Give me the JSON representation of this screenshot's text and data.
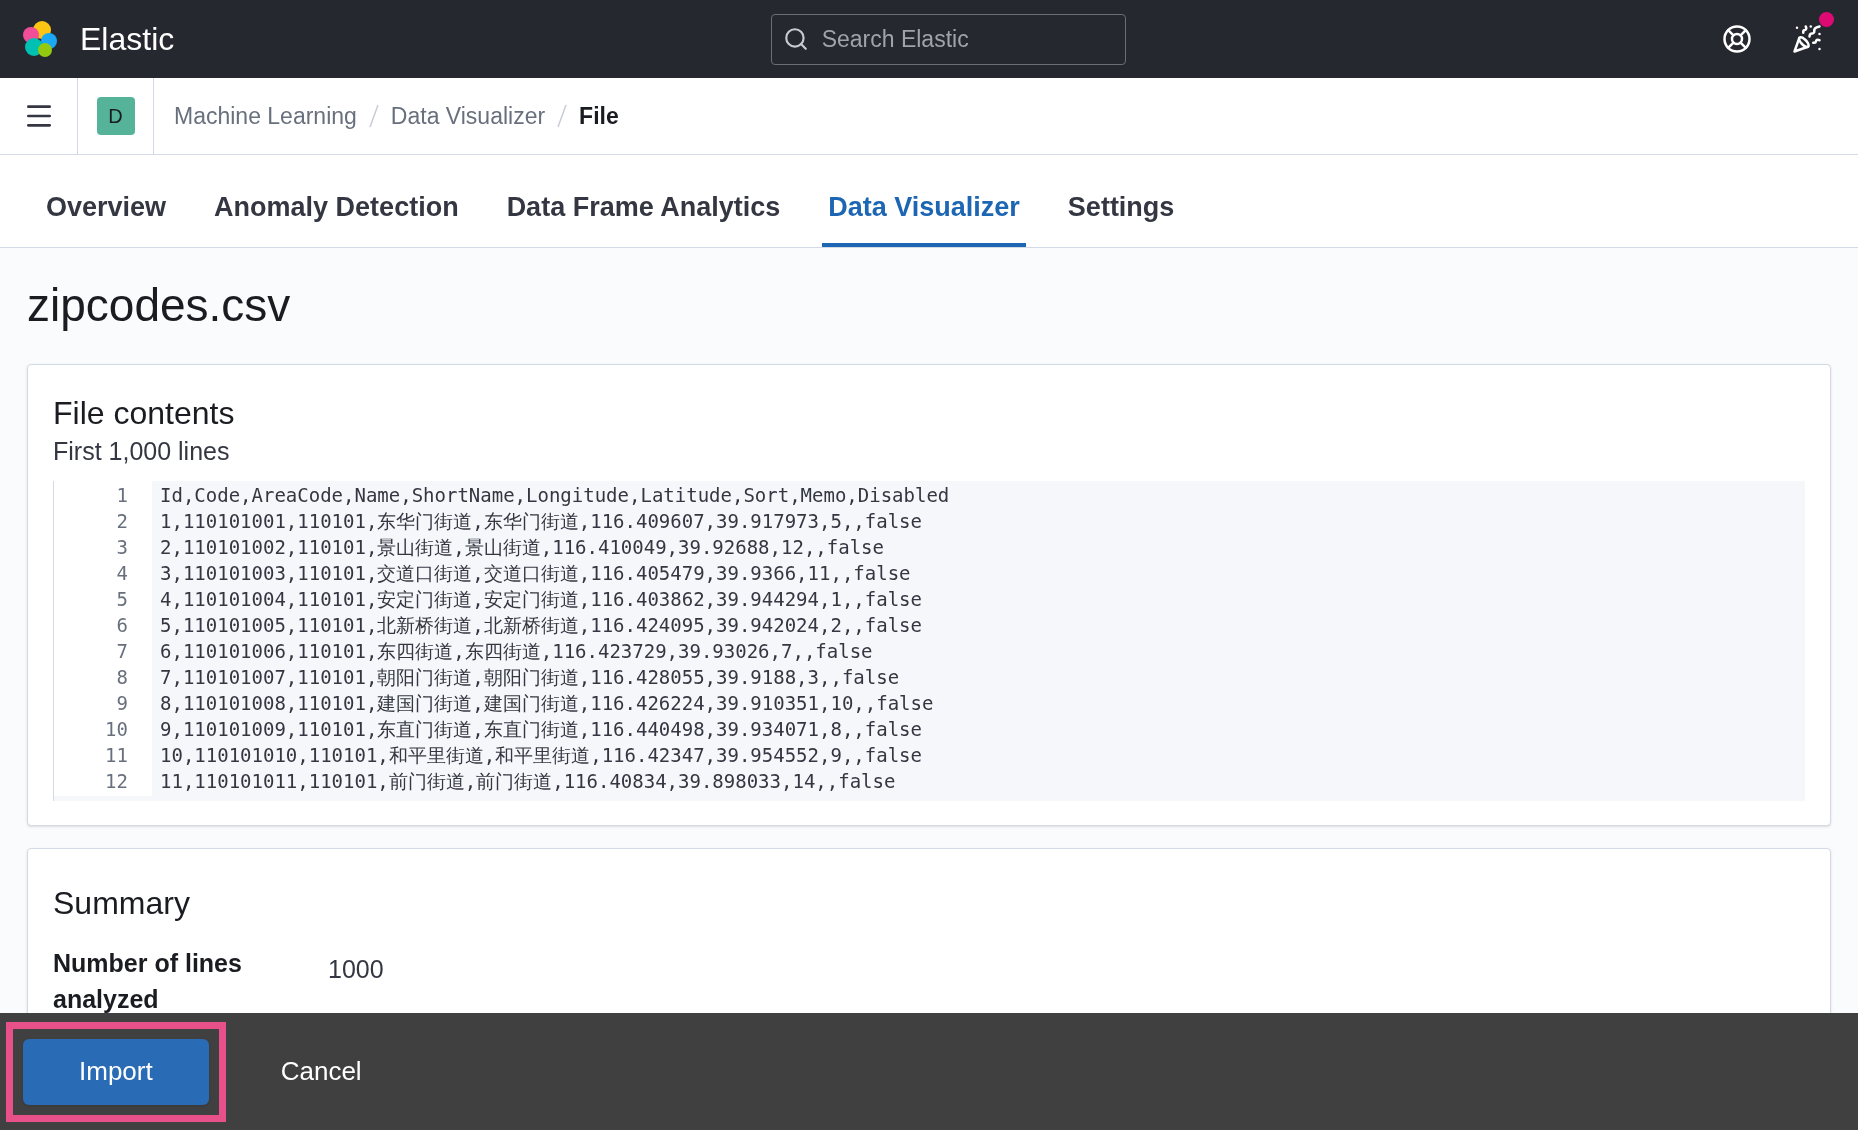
{
  "header": {
    "brand": "Elastic",
    "search": {
      "placeholder": "Search Elastic"
    },
    "newsfeed_unread": true
  },
  "nav": {
    "space_initial": "D",
    "breadcrumbs": [
      {
        "label": "Machine Learning",
        "selected": false
      },
      {
        "label": "Data Visualizer",
        "selected": false
      },
      {
        "label": "File",
        "selected": true
      }
    ]
  },
  "tabs": [
    {
      "label": "Overview",
      "selected": false
    },
    {
      "label": "Anomaly Detection",
      "selected": false
    },
    {
      "label": "Data Frame Analytics",
      "selected": false
    },
    {
      "label": "Data Visualizer",
      "selected": true
    },
    {
      "label": "Settings",
      "selected": false
    }
  ],
  "page_title": "zipcodes.csv",
  "file_contents": {
    "title": "File contents",
    "subtitle": "First 1,000 lines",
    "lines": [
      {
        "number": "1",
        "text": "Id,Code,AreaCode,Name,ShortName,Longitude,Latitude,Sort,Memo,Disabled"
      },
      {
        "number": "2",
        "text": "1,110101001,110101,东华门街道,东华门街道,116.409607,39.917973,5,,false"
      },
      {
        "number": "3",
        "text": "2,110101002,110101,景山街道,景山街道,116.410049,39.92688,12,,false"
      },
      {
        "number": "4",
        "text": "3,110101003,110101,交道口街道,交道口街道,116.405479,39.9366,11,,false"
      },
      {
        "number": "5",
        "text": "4,110101004,110101,安定门街道,安定门街道,116.403862,39.944294,1,,false"
      },
      {
        "number": "6",
        "text": "5,110101005,110101,北新桥街道,北新桥街道,116.424095,39.942024,2,,false"
      },
      {
        "number": "7",
        "text": "6,110101006,110101,东四街道,东四街道,116.423729,39.93026,7,,false"
      },
      {
        "number": "8",
        "text": "7,110101007,110101,朝阳门街道,朝阳门街道,116.428055,39.9188,3,,false"
      },
      {
        "number": "9",
        "text": "8,110101008,110101,建国门街道,建国门街道,116.426224,39.910351,10,,false"
      },
      {
        "number": "10",
        "text": "9,110101009,110101,东直门街道,东直门街道,116.440498,39.934071,8,,false"
      },
      {
        "number": "11",
        "text": "10,110101010,110101,和平里街道,和平里街道,116.42347,39.954552,9,,false"
      },
      {
        "number": "12",
        "text": "11,110101011,110101,前门街道,前门街道,116.40834,39.898033,14,,false"
      }
    ]
  },
  "summary": {
    "title": "Summary",
    "rows": [
      {
        "label": "Number of lines analyzed",
        "value": "1000"
      }
    ]
  },
  "footer": {
    "buttons": [
      {
        "label": "Import",
        "kind": "primary",
        "highlighted": true
      },
      {
        "label": "Cancel",
        "kind": "empty",
        "highlighted": false
      }
    ]
  }
}
